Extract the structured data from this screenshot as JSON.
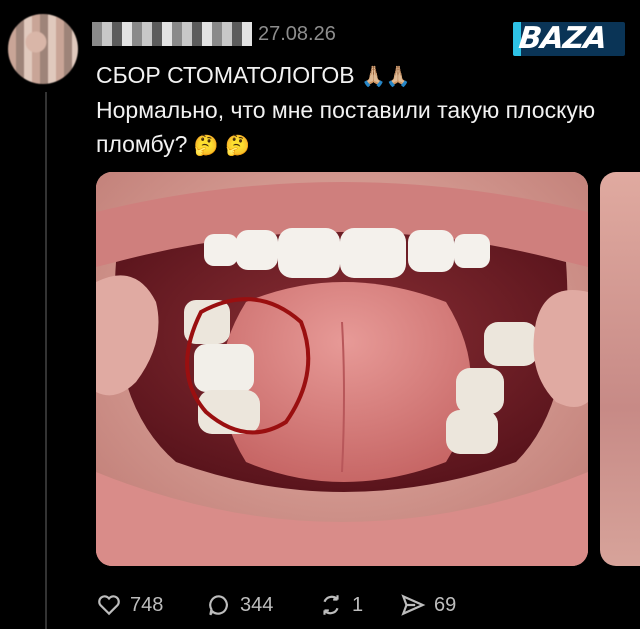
{
  "post": {
    "date": "27.08.26",
    "title": "СБОР СТОМАТОЛОГОВ",
    "title_emoji": "🙏🏼🙏🏼",
    "text": "Нормально, что мне поставили такую плоскую пломбу?",
    "text_emoji": "🤔 🤔"
  },
  "brand": {
    "logo_text": "BAZA",
    "logo_bg": "#0a3456",
    "logo_accent": "#2ec2e6"
  },
  "media": {
    "main_image": "open-mouth-photo",
    "annotation": "red-circle-marker"
  },
  "actions": {
    "likes": "748",
    "replies": "344",
    "reposts": "1",
    "shares": "69"
  },
  "icons": {
    "like": "heart-icon",
    "reply": "comment-bubble-icon",
    "repost": "repost-icon",
    "share": "send-icon"
  }
}
